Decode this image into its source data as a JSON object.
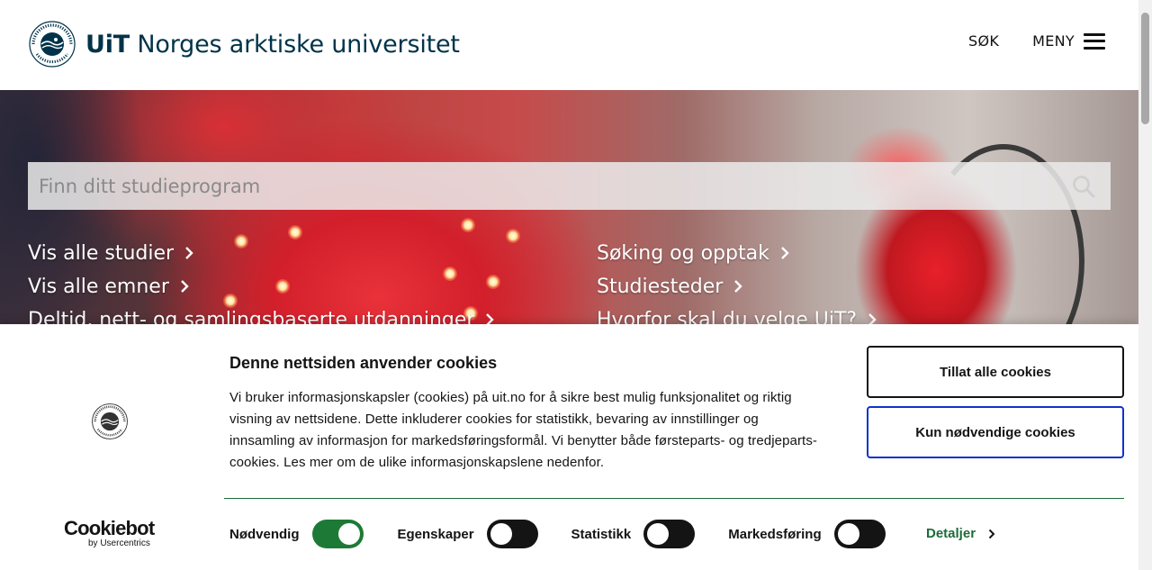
{
  "header": {
    "logo_brand": "UiT",
    "logo_name": "Norges arktiske universitet",
    "search_label": "SØK",
    "menu_label": "MENY"
  },
  "hero": {
    "search_placeholder": "Finn ditt studieprogram",
    "links": [
      "Vis alle studier",
      "Søking og opptak",
      "Vis alle emner",
      "Studiesteder",
      "Deltid, nett- og samlingsbaserte utdanninger",
      "Hvorfor skal du velge UiT?"
    ]
  },
  "cookie_banner": {
    "title": "Denne nettsiden anvender cookies",
    "body": "Vi bruker informasjonskapsler (cookies) på uit.no for å sikre best mulig funksjonalitet og riktig visning av nettsidene. Dette inkluderer cookies for statistikk, bevaring av innstillinger og innsamling av informasjon for markedsføringsformål. Vi benytter både førsteparts- og tredjeparts-cookies. Les mer om de ulike informasjonskapslene nedenfor.",
    "allow_all_label": "Tillat alle cookies",
    "necessary_only_label": "Kun nødvendige cookies",
    "provider_name": "Cookiebot",
    "provider_by": "by Usercentrics",
    "toggles": [
      {
        "label": "Nødvendig",
        "on": true
      },
      {
        "label": "Egenskaper",
        "on": false
      },
      {
        "label": "Statistikk",
        "on": false
      },
      {
        "label": "Markedsføring",
        "on": false
      }
    ],
    "details_label": "Detaljer"
  },
  "colors": {
    "brand_dark": "#003349",
    "toggle_on": "#1d7a36",
    "accent_green": "#1d6b3a",
    "focus_blue": "#1032cf"
  },
  "icons": {
    "logo": "uit-seal-icon",
    "search": "search-icon",
    "menu": "hamburger-icon",
    "link_arrow": "chevron-right-icon"
  }
}
